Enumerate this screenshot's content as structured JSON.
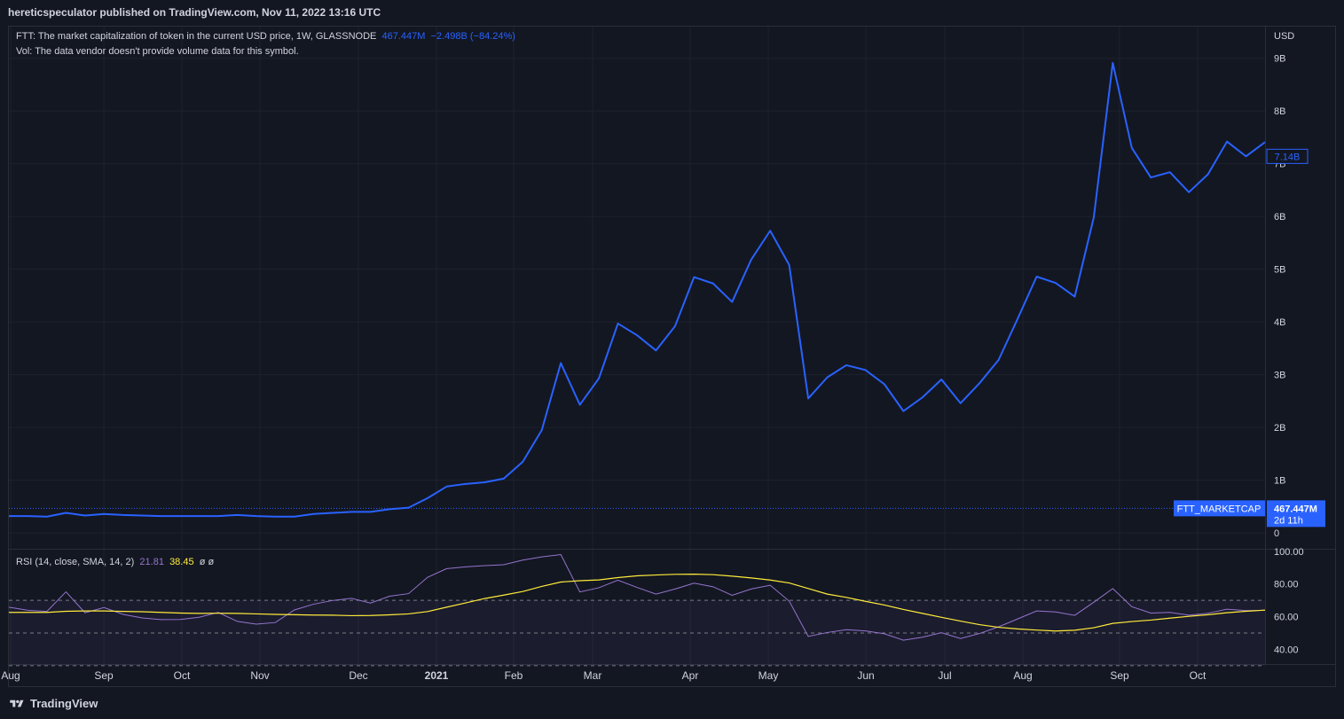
{
  "header": {
    "publisher_line": "hereticspeculator published on TradingView.com, Nov 11, 2022 13:16 UTC"
  },
  "legend": {
    "main_prefix": "FTT: The market capitalization of token in the current USD price, 1W, GLASSNODE",
    "main_value": "467.447M",
    "main_change": "−2.498B (−84.24%)",
    "volume_line": "Vol: The data vendor doesn't provide volume data for this symbol.",
    "rsi_prefix": "RSI (14, close, SMA, 14, 2)",
    "rsi_value": "21.81",
    "rsi_ma_value": "38.45",
    "rsi_extra": "ø ø"
  },
  "footer": {
    "brand": "TradingView"
  },
  "colors": {
    "background": "#131722",
    "grid": "#1e222d",
    "line": "#2962ff",
    "rsi": "#9575cd",
    "rsi_ma": "#ffeb3b",
    "text": "#d1d4dc"
  },
  "chart_data": [
    {
      "type": "line",
      "title": "FTT: The market capitalization of token in the current USD price, 1W, GLASSNODE",
      "ylabel": "USD",
      "y_ticks": [
        "0",
        "1B",
        "2B",
        "3B",
        "4B",
        "5B",
        "6B",
        "7B",
        "8B",
        "9B"
      ],
      "ylim": [
        -0.3,
        9.6
      ],
      "x_ticks": [
        "Aug",
        "Sep",
        "Oct",
        "Nov",
        "Dec",
        "2021",
        "Feb",
        "Mar",
        "Apr",
        "May",
        "Jun",
        "Jul",
        "Aug",
        "Sep",
        "Oct"
      ],
      "grid": true,
      "series": [
        {
          "name": "FTT_MARKETCAP",
          "unit": "B USD",
          "values": [
            0.32,
            0.32,
            0.31,
            0.38,
            0.33,
            0.36,
            0.34,
            0.33,
            0.32,
            0.32,
            0.32,
            0.32,
            0.34,
            0.32,
            0.31,
            0.31,
            0.36,
            0.38,
            0.4,
            0.4,
            0.45,
            0.48,
            0.66,
            0.88,
            0.93,
            0.96,
            1.03,
            1.35,
            1.95,
            3.22,
            2.43,
            2.93,
            3.97,
            3.75,
            3.46,
            3.92,
            4.85,
            4.73,
            4.38,
            5.18,
            5.73,
            5.08,
            2.55,
            2.95,
            3.18,
            3.09,
            2.82,
            2.31,
            2.57,
            2.91,
            2.46,
            2.84,
            3.28,
            4.06,
            4.86,
            4.74,
            4.48,
            5.98,
            8.91,
            7.3,
            6.74,
            6.84,
            6.46,
            6.8,
            7.42,
            7.14,
            7.41
          ]
        }
      ],
      "price_labels": [
        {
          "text": "7.14B",
          "value": 7.14
        },
        {
          "text": "467.447M",
          "subtext": "2d 11h",
          "value": 0.467,
          "name": "FTT_MARKETCAP"
        }
      ]
    },
    {
      "type": "line",
      "title": "RSI (14, close, SMA, 14, 2)",
      "y_ticks": [
        "40.00",
        "60.00",
        "80.00",
        "100.00"
      ],
      "ylim": [
        31,
        101
      ],
      "bands": [
        30,
        50,
        70
      ],
      "series": [
        {
          "name": "RSI",
          "values": [
            65.8,
            63.9,
            63.2,
            75.2,
            62.4,
            65.6,
            61.4,
            59.2,
            58.2,
            58.3,
            59.6,
            62.6,
            57.1,
            55.4,
            56.4,
            64.1,
            67.6,
            69.9,
            71.2,
            68.3,
            72.5,
            74.1,
            84.1,
            89.4,
            90.5,
            91.2,
            91.8,
            94.6,
            96.6,
            98.0,
            75.1,
            77.7,
            82.3,
            77.9,
            73.8,
            76.9,
            80.5,
            78.3,
            73.1,
            76.9,
            79.2,
            69.5,
            47.9,
            50.3,
            52.0,
            51.3,
            49.5,
            45.6,
            47.4,
            50.2,
            46.6,
            49.7,
            53.8,
            58.6,
            63.5,
            62.9,
            60.8,
            68.8,
            77.2,
            66.1,
            62.2,
            62.6,
            60.9,
            62.1,
            64.6,
            63.7,
            63.9
          ]
        },
        {
          "name": "RSI-based MA",
          "values": [
            62.6,
            62.6,
            62.6,
            63.3,
            63.5,
            63.5,
            63.2,
            63.0,
            62.6,
            62.2,
            62.0,
            62.1,
            62.0,
            61.7,
            61.4,
            61.2,
            61.0,
            60.9,
            60.6,
            60.7,
            61.1,
            61.7,
            63.1,
            65.8,
            68.4,
            71.1,
            73.2,
            75.4,
            78.5,
            81.2,
            82.0,
            82.5,
            83.9,
            85.0,
            85.5,
            85.9,
            86.0,
            85.7,
            84.8,
            83.7,
            82.4,
            80.6,
            77.2,
            73.8,
            71.8,
            69.4,
            67.1,
            64.4,
            62.0,
            59.6,
            57.3,
            55.1,
            53.5,
            52.5,
            51.8,
            51.2,
            51.7,
            53.2,
            55.9,
            57.0,
            57.9,
            59.1,
            60.2,
            61.2,
            62.4,
            63.3,
            64.0
          ]
        }
      ]
    }
  ]
}
